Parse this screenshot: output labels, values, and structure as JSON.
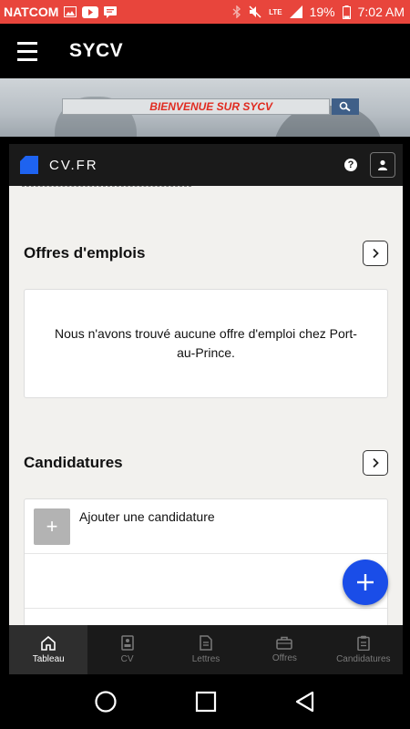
{
  "status_bar": {
    "carrier": "NATCOM",
    "battery": "19%",
    "time": "7:02 AM",
    "network": "LTE"
  },
  "app_bar": {
    "title": "SYCV"
  },
  "hero": {
    "search_banner": "BIENVENUE SUR SYCV"
  },
  "cv_bar": {
    "brand": "CV.FR"
  },
  "offers": {
    "title": "Offres d'emplois",
    "empty_message": "Nous n'avons trouvé aucune offre d'emploi chez Port-au-Prince."
  },
  "applications": {
    "title": "Candidatures",
    "add_label": "Ajouter une candidature"
  },
  "bottom_nav": {
    "items": [
      {
        "label": "Tableau",
        "icon": "home-icon",
        "active": true
      },
      {
        "label": "CV",
        "icon": "cv-icon",
        "active": false
      },
      {
        "label": "Lettres",
        "icon": "letter-icon",
        "active": false
      },
      {
        "label": "Offres",
        "icon": "briefcase-icon",
        "active": false
      },
      {
        "label": "Candidatures",
        "icon": "clipboard-icon",
        "active": false
      }
    ]
  },
  "colors": {
    "status_bar": "#e8453c",
    "accent_blue": "#1a4de8",
    "banner_text": "#e02a1f"
  }
}
